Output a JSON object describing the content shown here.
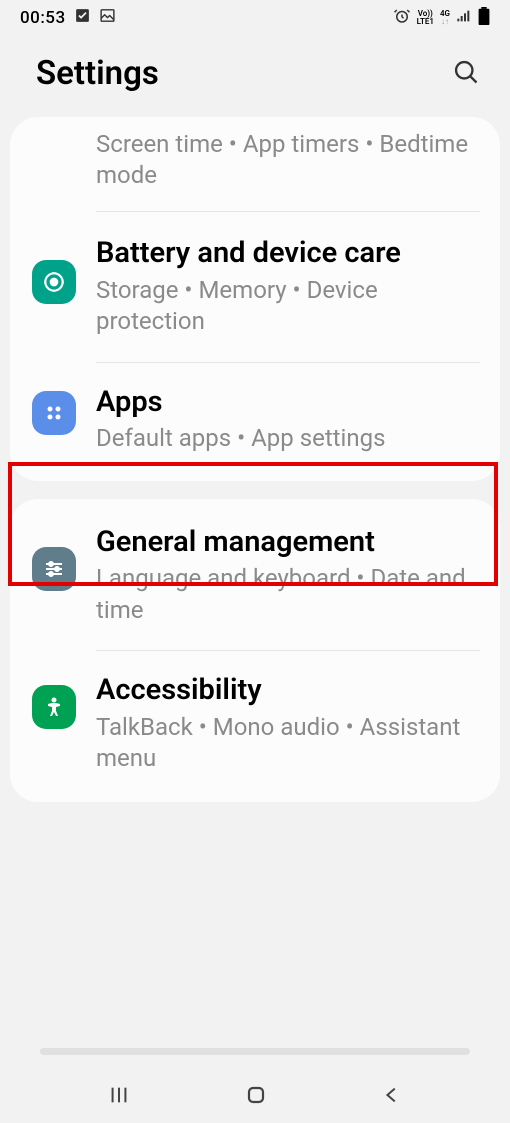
{
  "status": {
    "time": "00:53",
    "network_label_top": "Vo))",
    "network_label_bottom": "LTE1",
    "network_gen": "4G"
  },
  "header": {
    "title": "Settings"
  },
  "cards": [
    {
      "rows": [
        {
          "subtitle": "Screen time  •  App timers  •  Bedtime mode"
        },
        {
          "title": "Battery and device care",
          "subtitle": "Storage  •  Memory  •  Device protection",
          "icon": "device-care-icon",
          "icon_color": "icon-teal"
        },
        {
          "title": "Apps",
          "subtitle": "Default apps  •  App settings",
          "icon": "apps-icon",
          "icon_color": "icon-blue",
          "highlighted": true
        }
      ]
    },
    {
      "rows": [
        {
          "title": "General management",
          "subtitle": "Language and keyboard  •  Date and time",
          "icon": "general-icon",
          "icon_color": "icon-slate"
        },
        {
          "title": "Accessibility",
          "subtitle": "TalkBack  •  Mono audio  •  Assistant menu",
          "icon": "accessibility-icon",
          "icon_color": "icon-green"
        }
      ]
    }
  ]
}
